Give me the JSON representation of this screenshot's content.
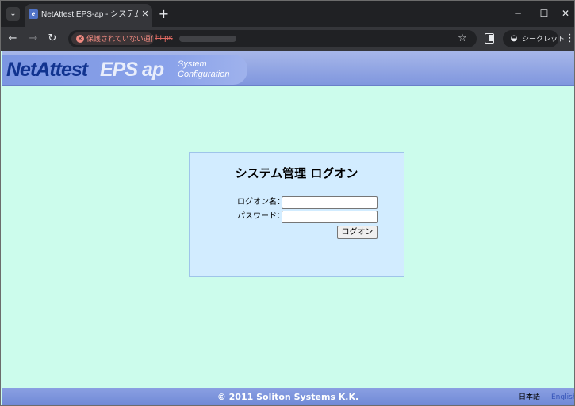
{
  "browser": {
    "tab_title": "NetAttest EPS-ap - システム管理",
    "tab_close": "✕",
    "new_tab": "+",
    "security_label": "保護されていない通信",
    "url_prefix": "https",
    "incognito_label": "シークレット",
    "window_controls": {
      "minimize": "─",
      "maximize": "☐",
      "close": "✕"
    }
  },
  "header": {
    "logo_main": "NetAttest",
    "logo_sub": "EPS ap",
    "logo_desc_line1": "System",
    "logo_desc_line2": "Configuration"
  },
  "login": {
    "title": "システム管理 ログオン",
    "username_label": "ログオン名：",
    "password_label": "パスワード：",
    "username_value": "",
    "password_value": "",
    "submit_label": "ログオン"
  },
  "footer": {
    "copyright": "© 2011 Soliton Systems K.K.",
    "lang_ja": "日本語",
    "lang_en": "English"
  },
  "colors": {
    "page_background": "#ccfcec",
    "login_box": "#d2ecff",
    "header_bar": "#7f96de",
    "logo_text": "#11338f"
  }
}
